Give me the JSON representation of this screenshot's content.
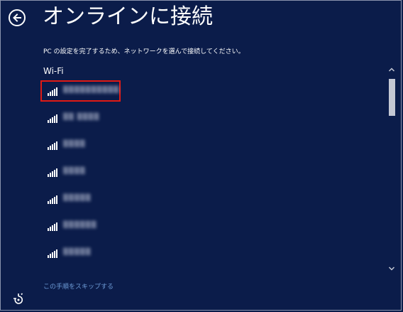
{
  "header": {
    "title": "オンラインに接続",
    "subtitle": "PC の設定を完了するため、ネットワークを選んで接続してください。"
  },
  "section": {
    "label": "Wi-Fi"
  },
  "networks": [
    {
      "ssid": "▒▒▒▒▒▒▒▒▒▒",
      "selected": true
    },
    {
      "ssid": "▒▒ ▒▒▒▒"
    },
    {
      "ssid": "▒▒▒▒"
    },
    {
      "ssid": "▒▒▒▒"
    },
    {
      "ssid": "▒▒▒▒▒"
    },
    {
      "ssid": "▒▒▒▒▒▒"
    },
    {
      "ssid": "▒▒▒▒▒"
    }
  ],
  "footer": {
    "skip_label": "この手順をスキップする"
  },
  "icons": {
    "back": "back-arrow-icon",
    "signal": "wifi-signal-icon",
    "accessibility": "ease-of-access-icon"
  },
  "colors": {
    "background": "#0b1c4a",
    "selection": "#e01a14",
    "link": "#6d9bd6",
    "text": "#ffffff"
  }
}
